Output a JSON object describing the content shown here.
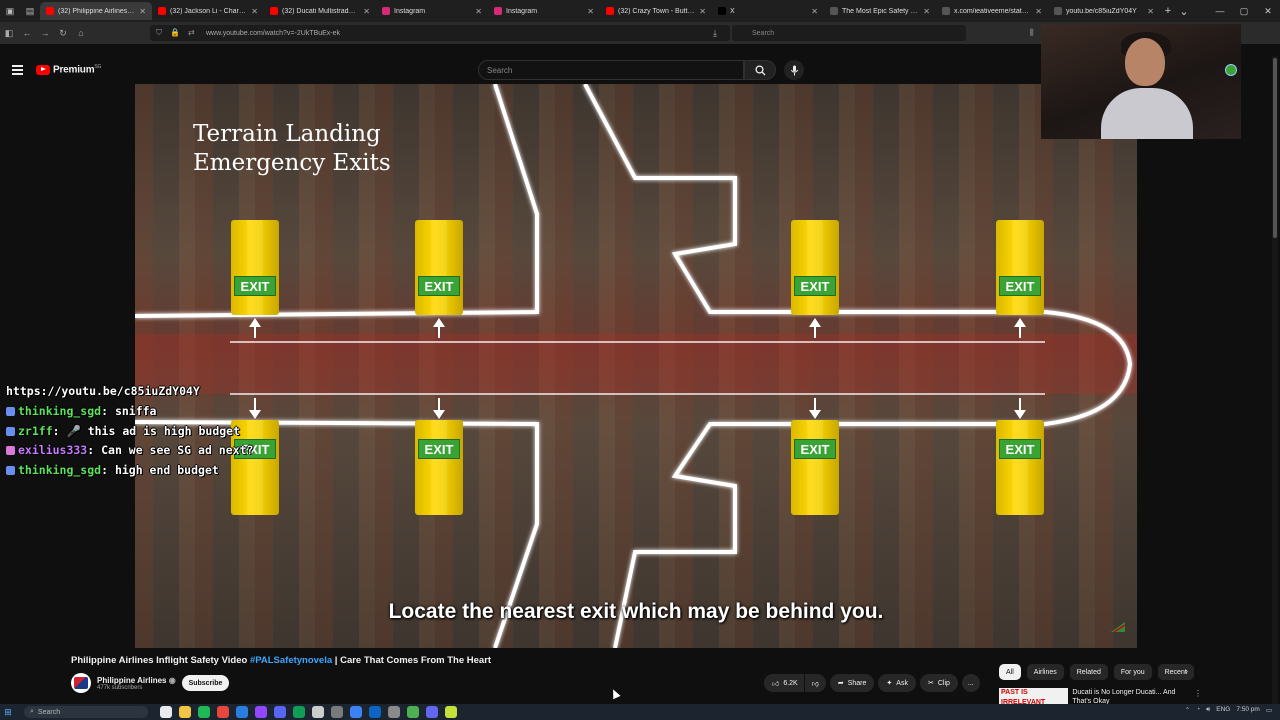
{
  "browser": {
    "tabs": [
      {
        "label": "(32) Philippine Airlines Infl",
        "color": "#ff0000",
        "active": true
      },
      {
        "label": "(32) Jackson Li - CharmCharm(",
        "color": "#ff0000",
        "active": false
      },
      {
        "label": "(32) Ducati Multistrada RS V4 S",
        "color": "#ff0000",
        "active": false
      },
      {
        "label": "Instagram",
        "color": "#d62976",
        "active": false
      },
      {
        "label": "Instagram",
        "color": "#d62976",
        "active": false
      },
      {
        "label": "(32) Crazy Town - Butterfly (Offi",
        "color": "#ff0000",
        "active": false
      },
      {
        "label": "X",
        "color": "#000000",
        "active": false
      },
      {
        "label": "The Most Epic Safety Video Eve",
        "color": "#555555",
        "active": false
      },
      {
        "label": "x.com/ieativeeme/status/200",
        "color": "#555555",
        "active": false
      },
      {
        "label": "youtu.be/c85iuZdY04Y",
        "color": "#555555",
        "active": false
      }
    ],
    "url": "www.youtube.com/watch?v=-2UkTBuEx-ek",
    "search_placeholder": "Search"
  },
  "youtube": {
    "brand": "Premium",
    "region": "SG",
    "search_placeholder": "Search"
  },
  "video": {
    "title_line1": "Terrain Landing",
    "title_line2": "Emergency Exits",
    "exit_label": "EXIT",
    "subtitle": "Locate the nearest exit which may be behind you."
  },
  "chat": [
    {
      "user": "",
      "text": "https://youtu.be/c85iuZdY04Y"
    },
    {
      "user": "thinking_sgd",
      "text": ": sniffa",
      "badge": "blue"
    },
    {
      "user": "zr1ff",
      "text": ": 🎤 this ad is high budget",
      "badge": "blue"
    },
    {
      "user": "exilius333",
      "text": ": Can we see SG ad next?",
      "badge": "pink",
      "purple": true
    },
    {
      "user": "thinking_sgd",
      "text": ": high end budget",
      "badge": "blue"
    }
  ],
  "meta": {
    "title_before": "Philippine Airlines Inflight Safety Video ",
    "hashtag": "#PALSafetynovela",
    "title_after": " | Care That Comes From The Heart",
    "channel": "Philippine Airlines",
    "subscribers": "477k subscribers",
    "subscribe_label": "Subscribe"
  },
  "actions": {
    "likes": "6.2K",
    "share": "Share",
    "ask": "Ask",
    "clip": "Clip",
    "more": "..."
  },
  "chips": [
    "All",
    "Airlines",
    "Related",
    "For you",
    "Recent"
  ],
  "related": {
    "thumb_text": "PAST IS IRRELEVANT",
    "title": "Ducati is No Longer Ducati... And That's Okay"
  },
  "taskbar": {
    "search": "Search",
    "lang": "ENG",
    "time": "7:50 pm"
  }
}
